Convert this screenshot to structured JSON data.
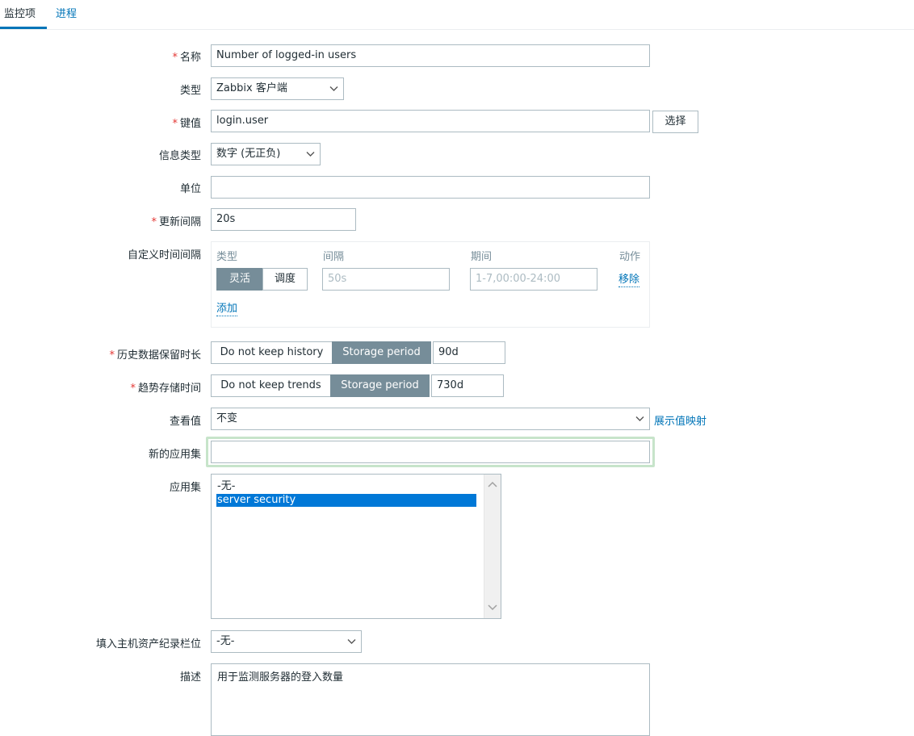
{
  "tabs": [
    {
      "label": "监控项",
      "active": true
    },
    {
      "label": "进程",
      "active": false
    }
  ],
  "form": {
    "name": {
      "label": "名称",
      "required": true,
      "value": "Number of logged-in users"
    },
    "type": {
      "label": "类型",
      "value": "Zabbix 客户端"
    },
    "key": {
      "label": "键值",
      "required": true,
      "value": "login.user",
      "select_button": "选择"
    },
    "info_type": {
      "label": "信息类型",
      "value": "数字 (无正负)"
    },
    "units": {
      "label": "单位",
      "value": ""
    },
    "update_interval": {
      "label": "更新间隔",
      "required": true,
      "value": "20s"
    },
    "custom_intervals": {
      "label": "自定义时间间隔",
      "headers": {
        "type": "类型",
        "interval": "间隔",
        "period": "期间",
        "action": "动作"
      },
      "row": {
        "type_options": [
          "灵活",
          "调度"
        ],
        "type_selected": "灵活",
        "interval_placeholder": "50s",
        "period_placeholder": "1-7,00:00-24:00",
        "remove": "移除"
      },
      "add": "添加"
    },
    "history": {
      "label": "历史数据保留时长",
      "required": true,
      "options": [
        "Do not keep history",
        "Storage period"
      ],
      "selected": "Storage period",
      "value": "90d"
    },
    "trends": {
      "label": "趋势存储时间",
      "required": true,
      "options": [
        "Do not keep trends",
        "Storage period"
      ],
      "selected": "Storage period",
      "value": "730d"
    },
    "show_value": {
      "label": "查看值",
      "value": "不变",
      "link": "展示值映射"
    },
    "new_application": {
      "label": "新的应用集",
      "value": ""
    },
    "applications": {
      "label": "应用集",
      "options": [
        "-无-",
        "server security"
      ],
      "selected": "server security"
    },
    "inventory_field": {
      "label": "填入主机资产纪录栏位",
      "value": "-无-"
    },
    "description": {
      "label": "描述",
      "value": "用于监测服务器的登入数量"
    }
  },
  "colors": {
    "accent": "#0275b8",
    "toggle_on": "#768d99",
    "required": "#e33734",
    "selection": "#0078d7",
    "focus": "#c7e4ca"
  }
}
